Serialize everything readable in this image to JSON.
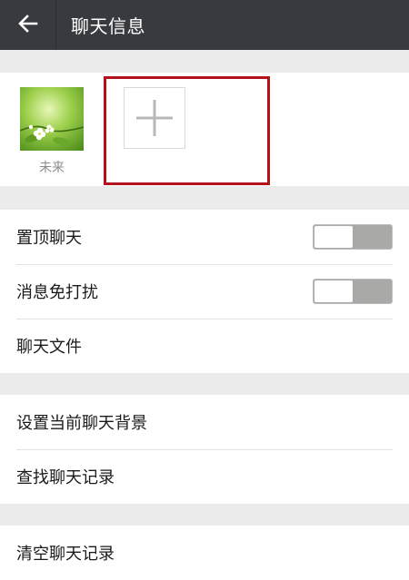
{
  "header": {
    "title": "聊天信息",
    "back_icon": "arrow-left-icon",
    "background": "#393a3f"
  },
  "members": [
    {
      "name": "未来",
      "avatar": "flower-avatar"
    }
  ],
  "add_member_icon": "plus-icon",
  "highlight_color": "#b3121c",
  "settings_group_1": {
    "pin_chat": {
      "label": "置顶聊天",
      "enabled": false
    },
    "mute": {
      "label": "消息免打扰",
      "enabled": false
    },
    "chat_files": {
      "label": "聊天文件"
    }
  },
  "settings_group_2": {
    "background": {
      "label": "设置当前聊天背景"
    },
    "search_history": {
      "label": "查找聊天记录"
    }
  },
  "settings_group_3": {
    "clear_history": {
      "label": "清空聊天记录"
    }
  }
}
